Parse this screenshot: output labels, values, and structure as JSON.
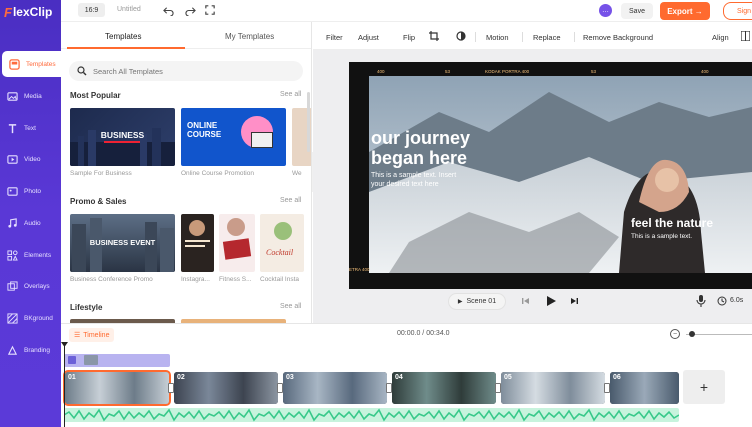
{
  "brand": {
    "logo_text": "lexClip",
    "accent": "#ff6a2f",
    "sidebar_color": "#5a38d6"
  },
  "topbar": {
    "aspect": "16:9",
    "project_title": "Untitled",
    "save_label": "Save",
    "export_label": "Export →",
    "signin_label": "Sign"
  },
  "sidebar": {
    "items": [
      {
        "label": "Templates",
        "icon": "templates-icon",
        "active": true
      },
      {
        "label": "Media",
        "icon": "media-icon"
      },
      {
        "label": "Text",
        "icon": "text-icon"
      },
      {
        "label": "Video",
        "icon": "video-icon"
      },
      {
        "label": "Photo",
        "icon": "photo-icon"
      },
      {
        "label": "Audio",
        "icon": "audio-icon"
      },
      {
        "label": "Elements",
        "icon": "elements-icon"
      },
      {
        "label": "Overlays",
        "icon": "overlays-icon"
      },
      {
        "label": "BKground",
        "icon": "background-icon"
      },
      {
        "label": "Branding",
        "icon": "branding-icon"
      }
    ]
  },
  "panel": {
    "tabs": [
      "Templates",
      "My Templates"
    ],
    "search_placeholder": "Search All Templates",
    "sections": [
      {
        "title": "Most Popular",
        "see_all": "See all",
        "items": [
          {
            "caption": "Sample For Business",
            "thumb_text": "BUSINESS"
          },
          {
            "caption": "Online Course Promotion",
            "thumb_text": "ONLINE COURSE"
          },
          {
            "caption": "We"
          }
        ]
      },
      {
        "title": "Promo & Sales",
        "see_all": "See all",
        "items": [
          {
            "caption": "Business Conference Promo",
            "thumb_text": "BUSINESS EVENT"
          },
          {
            "caption": "Instagra..."
          },
          {
            "caption": "Fitness S..."
          },
          {
            "caption": "Cocktail Insta"
          }
        ]
      },
      {
        "title": "Lifestyle",
        "see_all": "See all"
      }
    ]
  },
  "toolbar": {
    "items": [
      "Filter",
      "Adjust",
      "Flip",
      "Motion",
      "Replace",
      "Remove Background",
      "Align"
    ]
  },
  "canvas": {
    "headline_line1": "our journey",
    "headline_line2": "began here",
    "sample_text_1a": "This is a sample text. Insert",
    "sample_text_1b": "your desired text here",
    "headline_2": "feel the nature",
    "sample_text_2": "This is a sample text.",
    "film_codes_top": [
      "400",
      "53",
      "KODAK PORTRA 400",
      "53",
      "400"
    ],
    "film_code_bottom_left": "ETRA 400"
  },
  "playback": {
    "scene_label": "Scene 01",
    "duration": "6.0s"
  },
  "timeline": {
    "label": "Timeline",
    "time_readout": "00:00.0 / 00:34.0",
    "clips": [
      {
        "num": "01",
        "selected": true
      },
      {
        "num": "02"
      },
      {
        "num": "03"
      },
      {
        "num": "04"
      },
      {
        "num": "05"
      },
      {
        "num": "06"
      }
    ],
    "add_label": "+"
  }
}
